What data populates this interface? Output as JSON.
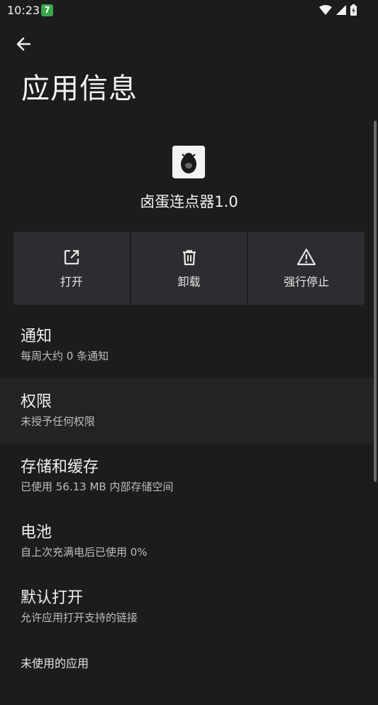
{
  "status_bar": {
    "time": "10:23",
    "badge": "7",
    "icons": [
      "wifi-icon",
      "cellular-signal-icon",
      "battery-icon"
    ]
  },
  "header": {
    "back_icon": "arrow-left-icon",
    "title": "应用信息"
  },
  "app": {
    "name": "卤蛋连点器1.0",
    "icon": "app-icon"
  },
  "actions": [
    {
      "label": "打开",
      "icon": "open-external-icon"
    },
    {
      "label": "卸载",
      "icon": "trash-icon"
    },
    {
      "label": "强行停止",
      "icon": "warning-icon"
    }
  ],
  "settings": [
    {
      "title": "通知",
      "subtitle": "每周大约 0 条通知"
    },
    {
      "title": "权限",
      "subtitle": "未授予任何权限"
    },
    {
      "title": "存储和缓存",
      "subtitle": "已使用 56.13 MB 内部存储空间"
    },
    {
      "title": "电池",
      "subtitle": "自上次充满电后已使用 0%"
    },
    {
      "title": "默认打开",
      "subtitle": "允许应用打开支持的链接"
    },
    {
      "title": "未使用的应用",
      "subtitle": ""
    }
  ],
  "colors": {
    "background": "#1c1c1d",
    "action_tile": "#2c2d30",
    "badge_green": "#3aa64a",
    "text_primary": "#f0f0f0",
    "text_secondary": "#bdbdbd"
  }
}
